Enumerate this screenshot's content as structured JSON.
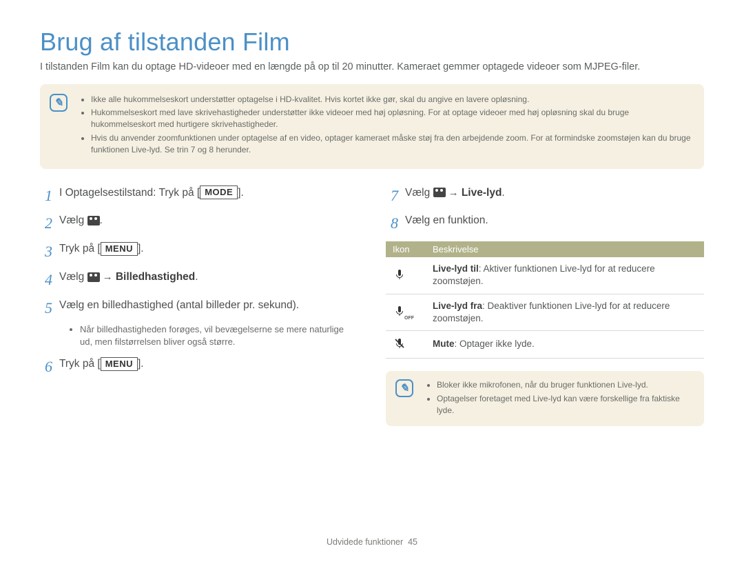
{
  "title": "Brug af tilstanden Film",
  "lead": "I tilstanden Film kan du optage HD-videoer med en længde på op til 20 minutter. Kameraet gemmer optagede videoer som MJPEG-filer.",
  "note_icon_glyph": "✎",
  "top_notes": [
    "Ikke alle hukommelseskort understøtter optagelse i HD-kvalitet. Hvis kortet ikke gør, skal du angive en lavere opløsning.",
    "Hukommelseskort med lave skrivehastigheder understøtter ikke videoer med høj opløsning. For at optage videoer med høj opløsning skal du bruge hukommelseskort med hurtigere skrivehastigheder.",
    "Hvis du anvender zoomfunktionen under optagelse af en video, optager kameraet måske støj fra den arbejdende zoom. For at formindske zoomstøjen kan du bruge funktionen Live-lyd. Se trin 7 og 8 herunder."
  ],
  "steps_left": {
    "s1_pre": "I Optagelsestilstand: Tryk på [",
    "s1_key": "MODE",
    "s1_post": "].",
    "s2_pre": "Vælg ",
    "s2_post": ".",
    "s3_pre": "Tryk på [",
    "s3_key": "MENU",
    "s3_post": "].",
    "s4_pre": "Vælg ",
    "s4_arrow": " → ",
    "s4_bold": "Billedhastighed",
    "s4_post": ".",
    "s5": "Vælg en billedhastighed (antal billeder pr. sekund).",
    "s5_sub": "Når billedhastigheden forøges, vil bevægelserne se mere naturlige ud, men filstørrelsen bliver også større.",
    "s6_pre": "Tryk på [",
    "s6_key": "MENU",
    "s6_post": "]."
  },
  "steps_right": {
    "s7_pre": "Vælg ",
    "s7_arrow": " → ",
    "s7_bold": "Live-lyd",
    "s7_post": ".",
    "s8": "Vælg en funktion."
  },
  "table": {
    "head_icon": "Ikon",
    "head_desc": "Beskrivelse",
    "rows": [
      {
        "icon": "mic-on",
        "bold": "Live-lyd til",
        "rest": ": Aktiver funktionen Live-lyd for at reducere zoomstøjen."
      },
      {
        "icon": "mic-off",
        "bold": "Live-lyd fra",
        "rest": ": Deaktiver funktionen Live-lyd for at reducere zoomstøjen."
      },
      {
        "icon": "mic-mute",
        "bold": "Mute",
        "rest": ": Optager ikke lyde."
      }
    ]
  },
  "bottom_notes": [
    "Bloker ikke mikrofonen, når du bruger funktionen Live-lyd.",
    "Optagelser foretaget med Live-lyd kan være forskellige fra faktiske lyde."
  ],
  "footer_label": "Udvidede funktioner",
  "footer_page": "45",
  "step_nums": {
    "n1": "1",
    "n2": "2",
    "n3": "3",
    "n4": "4",
    "n5": "5",
    "n6": "6",
    "n7": "7",
    "n8": "8"
  }
}
